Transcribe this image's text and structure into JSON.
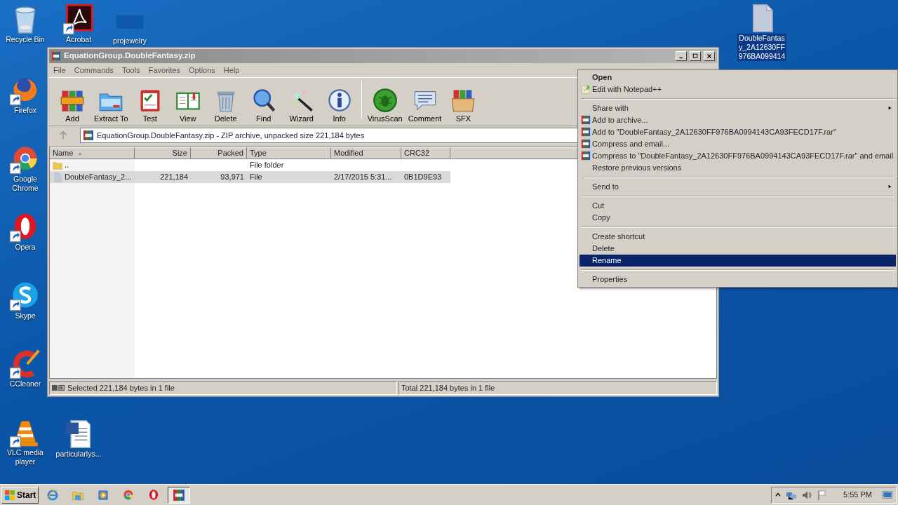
{
  "desktop_icons": [
    {
      "label": "Recycle Bin",
      "kind": "recycle",
      "shortcut": false,
      "selected": false
    },
    {
      "label": "Acrobat",
      "kind": "pdf",
      "shortcut": true,
      "selected": false
    },
    {
      "label": "projewelry",
      "kind": "blank",
      "shortcut": false,
      "selected": false
    },
    {
      "label": "Firefox",
      "kind": "firefox",
      "shortcut": true,
      "selected": false
    },
    {
      "label": "Google Chrome",
      "kind": "chrome",
      "shortcut": true,
      "selected": false
    },
    {
      "label": "Opera",
      "kind": "opera",
      "shortcut": true,
      "selected": false
    },
    {
      "label": "Skype",
      "kind": "skype",
      "shortcut": true,
      "selected": false
    },
    {
      "label": "CCleaner",
      "kind": "ccleaner",
      "shortcut": true,
      "selected": false
    },
    {
      "label": "VLC media player",
      "kind": "vlc",
      "shortcut": true,
      "selected": false
    },
    {
      "label": "particularlys...",
      "kind": "word",
      "shortcut": false,
      "selected": false
    },
    {
      "label": "DoubleFantasy_2A12630FF976BA099414",
      "kind": "file",
      "shortcut": false,
      "selected": true
    }
  ],
  "window": {
    "title": "EquationGroup.DoubleFantasy.zip",
    "menu": [
      "File",
      "Commands",
      "Tools",
      "Favorites",
      "Options",
      "Help"
    ],
    "toolbar": [
      {
        "label": "Add",
        "kind": "add"
      },
      {
        "label": "Extract To",
        "kind": "extract"
      },
      {
        "label": "Test",
        "kind": "test"
      },
      {
        "label": "View",
        "kind": "view"
      },
      {
        "label": "Delete",
        "kind": "delete"
      },
      {
        "label": "Find",
        "kind": "find"
      },
      {
        "label": "Wizard",
        "kind": "wizard"
      },
      {
        "label": "Info",
        "kind": "info"
      },
      {
        "label": "VirusScan",
        "kind": "virus"
      },
      {
        "label": "Comment",
        "kind": "comment"
      },
      {
        "label": "SFX",
        "kind": "sfx"
      }
    ],
    "address": "EquationGroup.DoubleFantasy.zip - ZIP archive, unpacked size 221,184 bytes",
    "columns": [
      {
        "label": "Name",
        "sorted": true
      },
      {
        "label": "Size",
        "sorted": false
      },
      {
        "label": "Packed",
        "sorted": false
      },
      {
        "label": "Type",
        "sorted": false
      },
      {
        "label": "Modified",
        "sorted": false
      },
      {
        "label": "CRC32",
        "sorted": false
      }
    ],
    "rows": [
      {
        "kind": "folder",
        "cells": [
          "..",
          "",
          "",
          "File folder",
          "",
          ""
        ],
        "selected": false
      },
      {
        "kind": "file",
        "cells": [
          "DoubleFantasy_2...",
          "221,184",
          "93,971",
          "File",
          "2/17/2015 5:31...",
          "0B1D9E93"
        ],
        "selected": true
      }
    ],
    "status_left": "Selected 221,184 bytes in 1 file",
    "status_right": "Total 221,184 bytes in 1 file"
  },
  "context_menu": [
    {
      "kind": "plain",
      "label": "Open",
      "bold": true,
      "submenu": false,
      "selected": false
    },
    {
      "kind": "notepad",
      "label": "Edit with Notepad++",
      "bold": false,
      "submenu": false,
      "selected": false
    },
    {
      "kind": "separator"
    },
    {
      "kind": "plain",
      "label": "Share with",
      "bold": false,
      "submenu": true,
      "selected": false
    },
    {
      "kind": "archive",
      "label": "Add to archive...",
      "bold": false,
      "submenu": false,
      "selected": false
    },
    {
      "kind": "archive",
      "label": "Add to \"DoubleFantasy_2A12630FF976BA0994143CA93FECD17F.rar\"",
      "bold": false,
      "submenu": false,
      "selected": false
    },
    {
      "kind": "archive",
      "label": "Compress and email...",
      "bold": false,
      "submenu": false,
      "selected": false
    },
    {
      "kind": "archive",
      "label": "Compress to \"DoubleFantasy_2A12630FF976BA0994143CA93FECD17F.rar\" and email",
      "bold": false,
      "submenu": false,
      "selected": false
    },
    {
      "kind": "plain",
      "label": "Restore previous versions",
      "bold": false,
      "submenu": false,
      "selected": false
    },
    {
      "kind": "separator"
    },
    {
      "kind": "plain",
      "label": "Send to",
      "bold": false,
      "submenu": true,
      "selected": false
    },
    {
      "kind": "separator"
    },
    {
      "kind": "plain",
      "label": "Cut",
      "bold": false,
      "submenu": false,
      "selected": false
    },
    {
      "kind": "plain",
      "label": "Copy",
      "bold": false,
      "submenu": false,
      "selected": false
    },
    {
      "kind": "separator"
    },
    {
      "kind": "plain",
      "label": "Create shortcut",
      "bold": false,
      "submenu": false,
      "selected": false
    },
    {
      "kind": "plain",
      "label": "Delete",
      "bold": false,
      "submenu": false,
      "selected": false
    },
    {
      "kind": "plain",
      "label": "Rename",
      "bold": false,
      "submenu": false,
      "selected": true
    },
    {
      "kind": "separator"
    },
    {
      "kind": "plain",
      "label": "Properties",
      "bold": false,
      "submenu": false,
      "selected": false
    }
  ],
  "taskbar": {
    "start": "Start",
    "apps": [
      {
        "kind": "ie",
        "active": false
      },
      {
        "kind": "explorer",
        "active": false
      },
      {
        "kind": "media",
        "active": false
      },
      {
        "kind": "chrome",
        "active": false
      },
      {
        "kind": "opera",
        "active": false
      },
      {
        "kind": "winrar",
        "active": true
      }
    ],
    "clock": "5:55 PM"
  }
}
